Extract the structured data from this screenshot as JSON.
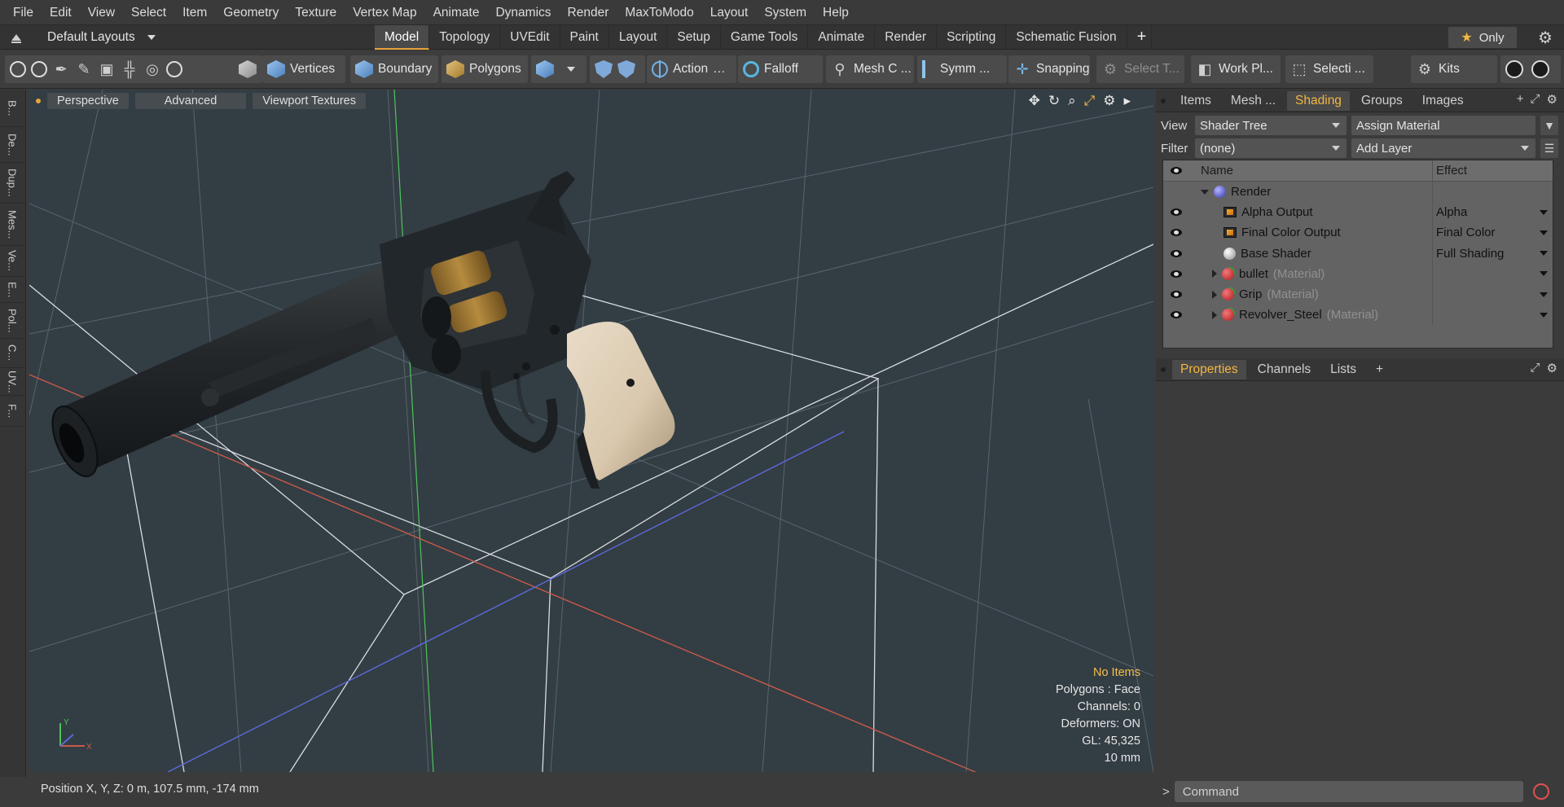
{
  "menubar": [
    "File",
    "Edit",
    "View",
    "Select",
    "Item",
    "Geometry",
    "Texture",
    "Vertex Map",
    "Animate",
    "Dynamics",
    "Render",
    "MaxToModo",
    "Layout",
    "System",
    "Help"
  ],
  "layout_menu": "Default Layouts",
  "tabs": [
    "Model",
    "Topology",
    "UVEdit",
    "Paint",
    "Layout",
    "Setup",
    "Game Tools",
    "Animate",
    "Render",
    "Scripting",
    "Schematic Fusion"
  ],
  "active_tab": "Model",
  "only_label": "Only",
  "toolbar": {
    "vertices": "Vertices",
    "boundary": "Boundary",
    "polygons": "Polygons",
    "action": "Action",
    "falloff": "Falloff",
    "mesh": "Mesh C ...",
    "symm": "Symm ...",
    "snapping": "Snapping",
    "select": "Select T...",
    "workplane": "Work Pl...",
    "selecti": "Selecti ...",
    "kits": "Kits"
  },
  "left_tabs": [
    "B...",
    "De...",
    "Dup...",
    "Mes...",
    "Ve...",
    "E...",
    "Pol...",
    "C...",
    "UV...",
    "F..."
  ],
  "viewport": {
    "buttons": [
      "Perspective",
      "Advanced",
      "Viewport Textures"
    ],
    "info": {
      "no_items": "No Items",
      "polygons": "Polygons : Face",
      "channels": "Channels: 0",
      "deformers": "Deformers: ON",
      "gl": "GL: 45,325",
      "scale": "10 mm"
    },
    "axis_y": "Y",
    "axis_x": "X"
  },
  "status": "Position X, Y, Z:   0 m, 107.5 mm, -174 mm",
  "right_tabs_top": [
    "Items",
    "Mesh ...",
    "Shading",
    "Groups",
    "Images"
  ],
  "active_right_tab": "Shading",
  "view_label": "View",
  "view_value": "Shader Tree",
  "assign_material": "Assign Material",
  "filter_label": "Filter",
  "filter_value": "(none)",
  "add_layer": "Add Layer",
  "tree": {
    "col_name": "Name",
    "col_effect": "Effect",
    "rows": [
      {
        "name": "Render",
        "sub": "",
        "effect": "",
        "icon": "ball-blue-icon"
      },
      {
        "name": "Alpha Output",
        "sub": "",
        "effect": "Alpha",
        "icon": "image-icon"
      },
      {
        "name": "Final Color Output",
        "sub": "",
        "effect": "Final Color",
        "icon": "image-icon"
      },
      {
        "name": "Base Shader",
        "sub": "",
        "effect": "Full Shading",
        "icon": "ball-white-icon"
      },
      {
        "name": "bullet",
        "sub": "(Material)",
        "effect": "",
        "icon": "material-icon"
      },
      {
        "name": "Grip",
        "sub": "(Material)",
        "effect": "",
        "icon": "material-icon"
      },
      {
        "name": "Revolver_Steel",
        "sub": "(Material)",
        "effect": "",
        "icon": "material-icon"
      }
    ]
  },
  "right_tabs_bottom": [
    "Properties",
    "Channels",
    "Lists"
  ],
  "active_bottom_tab": "Properties",
  "command_placeholder": "Command",
  "colors": {
    "accent": "#f3b641",
    "viewport_bg": "#333d44",
    "panel_bg": "#3b3b3b"
  }
}
